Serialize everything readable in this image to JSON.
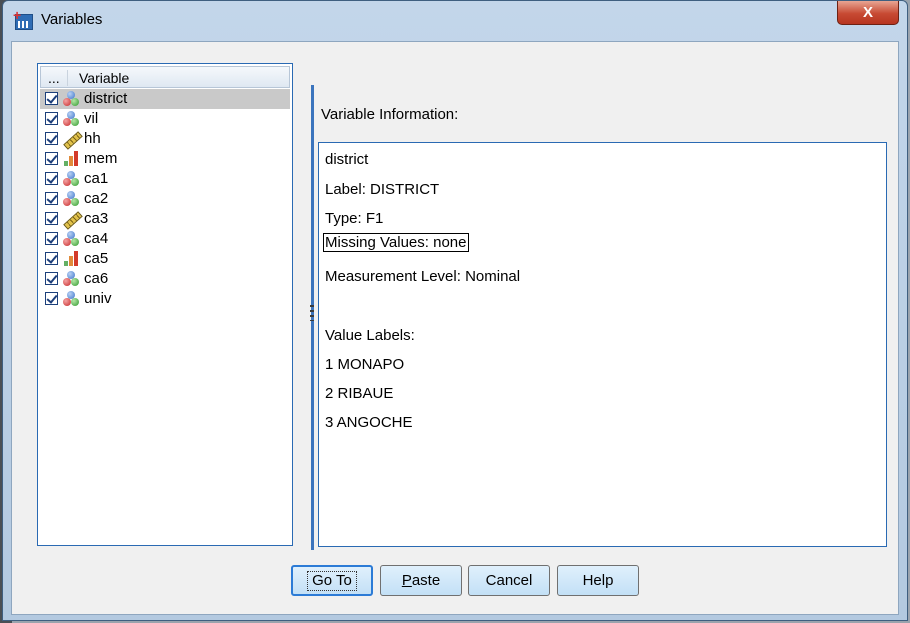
{
  "window": {
    "title": "Variables",
    "close_label": "X"
  },
  "list": {
    "header_dots": "...",
    "header_label": "Variable",
    "items": [
      {
        "name": "district",
        "type": "nominal",
        "checked": true,
        "selected": true
      },
      {
        "name": "vil",
        "type": "nominal",
        "checked": true
      },
      {
        "name": "hh",
        "type": "scale",
        "checked": true
      },
      {
        "name": "mem",
        "type": "ordinal",
        "checked": true
      },
      {
        "name": "ca1",
        "type": "nominal",
        "checked": true
      },
      {
        "name": "ca2",
        "type": "nominal",
        "checked": true
      },
      {
        "name": "ca3",
        "type": "scale",
        "checked": true
      },
      {
        "name": "ca4",
        "type": "nominal",
        "checked": true
      },
      {
        "name": "ca5",
        "type": "ordinal",
        "checked": true
      },
      {
        "name": "ca6",
        "type": "nominal",
        "checked": true
      },
      {
        "name": "univ",
        "type": "nominal",
        "checked": true
      }
    ]
  },
  "info": {
    "heading": "Variable Information:",
    "lines": [
      "district",
      "Label:  DISTRICT",
      "Type:  F1",
      "Missing Values:  none",
      "Measurement Level:  Nominal",
      "",
      "Value Labels:",
      "1   MONAPO",
      "2   RIBAUE",
      "3   ANGOCHE"
    ]
  },
  "buttons": {
    "goto": "Go To",
    "paste_first": "P",
    "paste_rest": "aste",
    "cancel": "Cancel",
    "help": "Help"
  },
  "colors": {
    "selection": "#c9c9c9",
    "accent_border": "#2a6ab3",
    "close_button": "#c74a33"
  }
}
